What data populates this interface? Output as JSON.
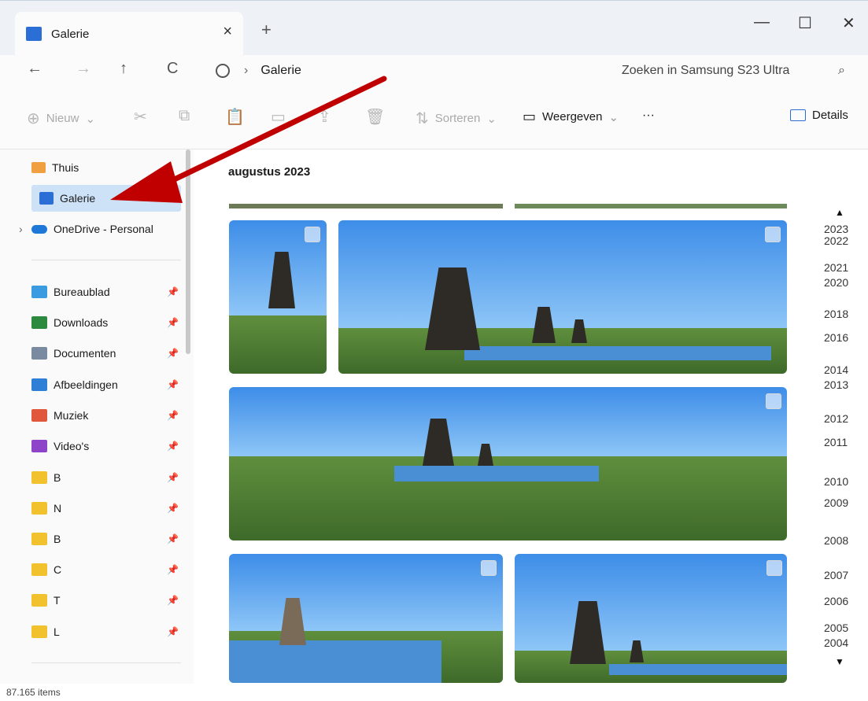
{
  "window": {
    "tab_title": "Galerie",
    "tab_close": "×",
    "new_tab": "+",
    "minimize": "—",
    "maximize": "☐",
    "close": "✕"
  },
  "nav": {
    "back": "←",
    "forward": "→",
    "up": "↑",
    "refresh": "C",
    "breadcrumb_sep": "›",
    "location": "Galerie",
    "search_placeholder": "Zoeken in Samsung S23 Ultra",
    "search_icon": "⌕"
  },
  "commands": {
    "new": "Nieuw",
    "sort": "Sorteren",
    "view": "Weergeven",
    "more": "···",
    "details": "Details"
  },
  "sidebar": {
    "top": [
      {
        "label": "Thuis",
        "icon": "home-icon"
      },
      {
        "label": "Galerie",
        "icon": "gallery-icon",
        "selected": true
      },
      {
        "label": "OneDrive - Personal",
        "icon": "cloud-icon"
      }
    ],
    "pinned": [
      {
        "label": "Bureaublad",
        "color": "#3a9be0"
      },
      {
        "label": "Downloads",
        "color": "#2b8a3e"
      },
      {
        "label": "Documenten",
        "color": "#7a8aa0"
      },
      {
        "label": "Afbeeldingen",
        "color": "#2f7fd6"
      },
      {
        "label": "Muziek",
        "color": "#e0573c"
      },
      {
        "label": "Video's",
        "color": "#8e44c9"
      },
      {
        "label": "B",
        "color": "#f2c12e"
      },
      {
        "label": "N",
        "color": "#f2c12e"
      },
      {
        "label": "B",
        "color": "#f2c12e"
      },
      {
        "label": "C",
        "color": "#f2c12e"
      },
      {
        "label": "T",
        "color": "#f2c12e"
      },
      {
        "label": "L",
        "color": "#f2c12e"
      }
    ],
    "pin_glyph": "📌"
  },
  "status": "87.165 items",
  "gallery": {
    "month": "augustus 2023"
  },
  "timeline": {
    "up": "▲",
    "down": "▼",
    "years": [
      "2023",
      "2022",
      "2021",
      "2020",
      "2018",
      "2016",
      "2014",
      "2013",
      "2012",
      "2011",
      "2010",
      "2009",
      "2008",
      "2007",
      "2006",
      "2005",
      "2004"
    ]
  }
}
